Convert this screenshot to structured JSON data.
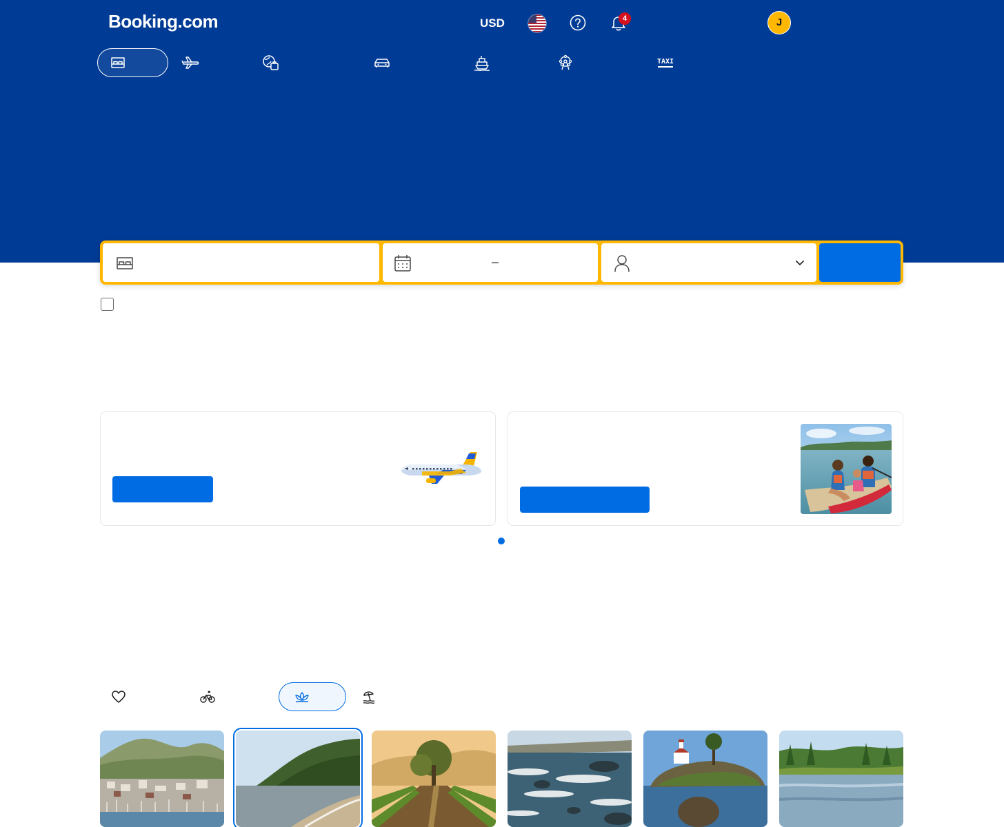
{
  "header": {
    "logo": "Booking.com",
    "currency": "USD",
    "notification_count": "4",
    "avatar_initial": "J"
  },
  "nav_tabs": [
    {
      "icon": "bed-icon",
      "active": true
    },
    {
      "icon": "plane-icon",
      "active": false
    },
    {
      "icon": "flight-hotel-icon",
      "active": false
    },
    {
      "icon": "car-icon",
      "active": false
    },
    {
      "icon": "attractions-icon",
      "active": false
    },
    {
      "icon": "ferris-wheel-icon",
      "active": false
    },
    {
      "icon": "taxi-icon",
      "active": false
    }
  ],
  "taxi_label": "TAXI",
  "search": {
    "destination_icon": "bed-icon",
    "dates_icon": "calendar-icon",
    "dates_separator": "–",
    "occupancy_icon": "person-icon"
  },
  "colors": {
    "brand_blue": "#003b95",
    "action_blue": "#006ce4",
    "search_yellow": "#ffb700",
    "badge_red": "#d4111e"
  },
  "trip_tabs": [
    {
      "icon": "heart-icon",
      "active": false
    },
    {
      "icon": "bicycle-icon",
      "active": false
    },
    {
      "icon": "lotus-icon",
      "active": true
    },
    {
      "icon": "beach-icon",
      "active": false
    }
  ]
}
